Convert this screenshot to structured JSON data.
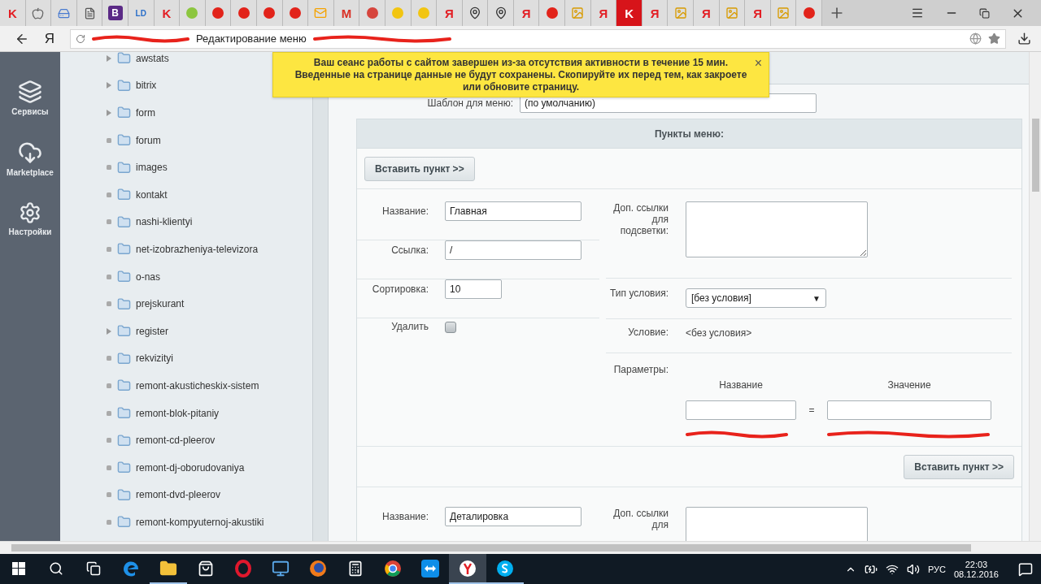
{
  "browser": {
    "tabs": [
      {
        "kind": "letter",
        "glyph": "K",
        "color": "#e31e24",
        "selected": false
      },
      {
        "kind": "apple",
        "selected": false
      },
      {
        "kind": "drive",
        "selected": false
      },
      {
        "kind": "page",
        "selected": false
      },
      {
        "kind": "badge",
        "glyph": "B",
        "color": "#5b2a86",
        "selected": false
      },
      {
        "kind": "letter",
        "glyph": "LD",
        "color": "#2a6fc9",
        "selected": false
      },
      {
        "kind": "letter",
        "glyph": "K",
        "color": "#e31e24",
        "selected": false
      },
      {
        "kind": "circle",
        "color": "#8cc63f",
        "selected": false
      },
      {
        "kind": "circle",
        "color": "#e2231a",
        "selected": false
      },
      {
        "kind": "circle",
        "color": "#e2231a",
        "selected": false
      },
      {
        "kind": "circle",
        "color": "#e2231a",
        "selected": false
      },
      {
        "kind": "circle",
        "color": "#e2231a",
        "selected": false
      },
      {
        "kind": "mail",
        "color": "#f5a300",
        "selected": false
      },
      {
        "kind": "letter",
        "glyph": "M",
        "color": "#d93025",
        "selected": false
      },
      {
        "kind": "circle",
        "color": "#d6453d",
        "selected": false
      },
      {
        "kind": "circle",
        "color": "#f2c511",
        "selected": false
      },
      {
        "kind": "circle",
        "color": "#f2c511",
        "selected": false
      },
      {
        "kind": "letter",
        "glyph": "Я",
        "color": "#e31e24",
        "selected": false
      },
      {
        "kind": "pin",
        "selected": false
      },
      {
        "kind": "pin",
        "selected": false
      },
      {
        "kind": "letter",
        "glyph": "Я",
        "color": "#e31e24",
        "selected": false
      },
      {
        "kind": "circle",
        "color": "#e2231a",
        "selected": false
      },
      {
        "kind": "image",
        "selected": false
      },
      {
        "kind": "letter",
        "glyph": "Я",
        "color": "#e31e24",
        "selected": false
      },
      {
        "kind": "letter",
        "glyph": "K",
        "color": "#ffffff",
        "selected": true
      },
      {
        "kind": "letter",
        "glyph": "Я",
        "color": "#e31e24",
        "selected": false
      },
      {
        "kind": "image",
        "selected": false
      },
      {
        "kind": "letter",
        "glyph": "Я",
        "color": "#e31e24",
        "selected": false
      },
      {
        "kind": "image",
        "selected": false
      },
      {
        "kind": "letter",
        "glyph": "Я",
        "color": "#e31e24",
        "selected": false
      },
      {
        "kind": "image",
        "selected": false
      },
      {
        "kind": "circle",
        "color": "#e2231a",
        "selected": false
      }
    ],
    "logo": "Я",
    "page_title": "Редактирование меню"
  },
  "sidebar": {
    "items": [
      {
        "kind": "layers",
        "label": "Сервисы"
      },
      {
        "kind": "cloud",
        "label": "Marketplace"
      },
      {
        "kind": "gear",
        "label": "Настройки"
      }
    ]
  },
  "tree": {
    "items": [
      {
        "name": "awstats",
        "expandable": true
      },
      {
        "name": "bitrix",
        "expandable": true
      },
      {
        "name": "form",
        "expandable": true
      },
      {
        "name": "forum",
        "expandable": false
      },
      {
        "name": "images",
        "expandable": false
      },
      {
        "name": "kontakt",
        "expandable": false
      },
      {
        "name": "nashi-klientyi",
        "expandable": false
      },
      {
        "name": "net-izobrazheniya-televizora",
        "expandable": false
      },
      {
        "name": "o-nas",
        "expandable": false
      },
      {
        "name": "prejskurant",
        "expandable": false
      },
      {
        "name": "register",
        "expandable": true
      },
      {
        "name": "rekvizityi",
        "expandable": false
      },
      {
        "name": "remont-akusticheskix-sistem",
        "expandable": false
      },
      {
        "name": "remont-blok-pitaniy",
        "expandable": false
      },
      {
        "name": "remont-cd-pleerov",
        "expandable": false
      },
      {
        "name": "remont-dj-oborudovaniya",
        "expandable": false
      },
      {
        "name": "remont-dvd-pleerov",
        "expandable": false
      },
      {
        "name": "remont-kompyuternoj-akustiki",
        "expandable": false
      }
    ]
  },
  "notice": {
    "text": "Ваш сеанс работы с сайтом завершен из-за отсутствия активности в течение 15 мин. Введенные на странице данные не будут сохранены. Скопируйте их перед тем, как закроете или обновите страницу.",
    "close": "×"
  },
  "form": {
    "template_label": "Шаблон для меню:",
    "template_value": "(по умолчанию)",
    "section_title": "Пункты меню:",
    "blocks": [
      {
        "kind": "insert",
        "label": "Вставить пункт >>"
      },
      {
        "kind": "item",
        "name_label": "Название:",
        "name": "Главная",
        "link_label": "Ссылка:",
        "link": "/",
        "sort_label": "Сортировка:",
        "sort": "10",
        "delete_label": "Удалить",
        "delete_checked": false,
        "extra_label": "Доп. ссылки для подсветки:",
        "type_label": "Тип условия:",
        "type_value": "[без условия]",
        "type_caret": "▼",
        "condition_label": "Условие:",
        "condition_value": "<без условия>",
        "params_label": "Параметры:",
        "param_name_header": "Название",
        "param_value_header": "Значение",
        "equals": "="
      },
      {
        "kind": "append",
        "label": "Вставить пункт >>"
      },
      {
        "kind": "item",
        "name_label": "Название:",
        "name": "Деталировка",
        "extra_label": "Доп. ссылки для"
      }
    ]
  },
  "taskbar": {
    "apps": [
      {
        "kind": "start",
        "running": false,
        "selected": false
      },
      {
        "kind": "search",
        "running": false,
        "selected": false
      },
      {
        "kind": "taskview",
        "running": false,
        "selected": false
      },
      {
        "kind": "edge",
        "running": false,
        "selected": false
      },
      {
        "kind": "explorer",
        "running": true,
        "selected": false
      },
      {
        "kind": "store",
        "running": false,
        "selected": false
      },
      {
        "kind": "opera",
        "running": false,
        "selected": false
      },
      {
        "kind": "monitor",
        "running": false,
        "selected": false
      },
      {
        "kind": "firefox",
        "running": false,
        "selected": false
      },
      {
        "kind": "calculator",
        "running": false,
        "selected": false
      },
      {
        "kind": "chrome",
        "running": false,
        "selected": false
      },
      {
        "kind": "teamviewer",
        "running": false,
        "selected": false
      },
      {
        "kind": "yandex",
        "running": true,
        "selected": true
      },
      {
        "kind": "skype",
        "running": true,
        "selected": false
      }
    ],
    "language": "РУС",
    "time": "22:03",
    "date": "08.12.2016"
  }
}
